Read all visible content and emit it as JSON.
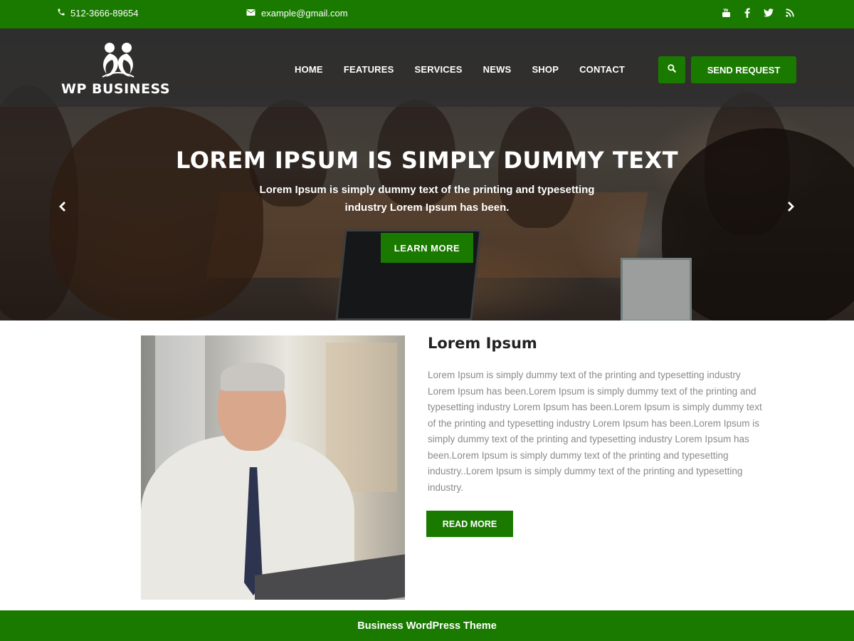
{
  "topbar": {
    "phone": "512-3666-89654",
    "email": "example@gmail.com",
    "socials": [
      {
        "icon": "youtube-icon"
      },
      {
        "icon": "facebook-icon"
      },
      {
        "icon": "twitter-icon"
      },
      {
        "icon": "rss-icon"
      }
    ]
  },
  "header": {
    "brand": "WP BUSINESS",
    "nav": [
      "HOME",
      "FEATURES",
      "SERVICES",
      "NEWS",
      "SHOP",
      "CONTACT"
    ],
    "send_request": "SEND REQUEST"
  },
  "slider": {
    "title": "LOREM IPSUM IS SIMPLY DUMMY TEXT",
    "text": "Lorem Ipsum is simply dummy text of the printing and typesetting industry Lorem Ipsum has been.",
    "button": "LEARN MORE"
  },
  "about": {
    "title": "Lorem Ipsum",
    "text": "Lorem Ipsum is simply dummy text of the printing and typesetting industry Lorem Ipsum has been.Lorem Ipsum is simply dummy text of the printing and typesetting industry Lorem Ipsum has been.Lorem Ipsum is simply dummy text of the printing and typesetting industry Lorem Ipsum has been.Lorem Ipsum is simply dummy text of the printing and typesetting industry Lorem Ipsum has been.Lorem Ipsum is simply dummy text of the printing and typesetting industry..Lorem Ipsum is simply dummy text of the printing and typesetting industry.",
    "button": "READ MORE"
  },
  "footer": {
    "text": "Business WordPress Theme"
  },
  "colors": {
    "primary": "#1a7a00",
    "header_overlay": "#2d2d2d",
    "body_text": "#8a8a8a",
    "heading": "#222222"
  }
}
